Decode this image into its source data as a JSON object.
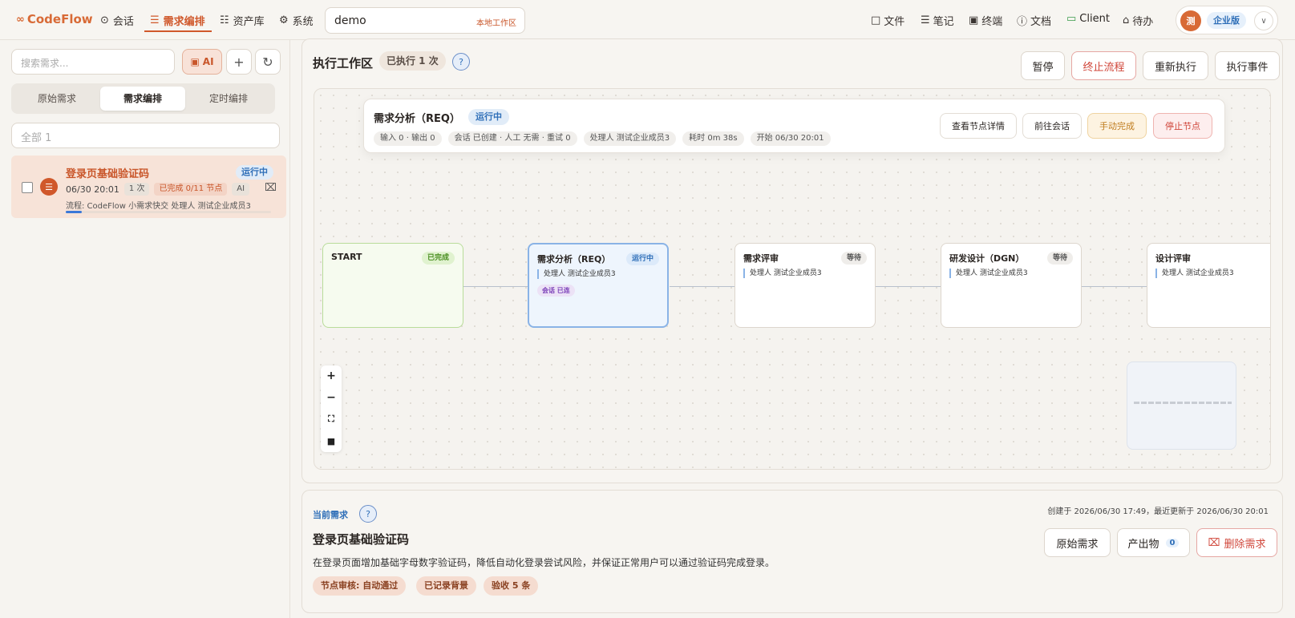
{
  "app": {
    "logo": "CodeFlow"
  },
  "nav": [
    {
      "label": "会话",
      "icon": "chat-bubble-icon"
    },
    {
      "label": "需求编排",
      "icon": "document-icon"
    },
    {
      "label": "资产库",
      "icon": "hierarchy-icon"
    },
    {
      "label": "系统",
      "icon": "gear-icon"
    }
  ],
  "workspace": {
    "value": "demo",
    "badge": "本地工作区"
  },
  "top_right": [
    {
      "label": "文件",
      "icon": "folder-icon"
    },
    {
      "label": "笔记",
      "icon": "note-icon"
    },
    {
      "label": "终端",
      "icon": "terminal-icon"
    },
    {
      "label": "文档",
      "icon": "help-circle-icon"
    },
    {
      "label": "Client",
      "icon": "monitor-icon"
    },
    {
      "label": "待办",
      "icon": "bell-icon"
    }
  ],
  "user": {
    "avatar": "测",
    "edition": "企业版"
  },
  "sidebar": {
    "search_placeholder": "搜索需求...",
    "ai_label": "AI",
    "tabs": [
      "原始需求",
      "需求编排",
      "定时编排"
    ],
    "filter": "全部 1",
    "request": {
      "title": "登录页基础验证码",
      "status": "运行中",
      "time": "06/30 20:01",
      "count": "1 次",
      "progress_text": "已完成 0/11 节点",
      "progress": 0.08,
      "ai": "AI",
      "flow": "流程: CodeFlow 小需求快交",
      "handler": "处理人 测试企业成员3"
    }
  },
  "workarea": {
    "title": "执行工作区",
    "exec_badge": "已执行 1 次",
    "buttons": [
      "暂停",
      "终止流程",
      "重新执行",
      "执行事件"
    ]
  },
  "info_card": {
    "title": "需求分析（REQ）",
    "status": "运行中",
    "chips": [
      "输入 0 · 输出 0",
      "会话 已创建 · 人工 无需 · 重试 0",
      "处理人 测试企业成员3",
      "耗时 0m 38s",
      "开始 06/30 20:01"
    ],
    "buttons": [
      "查看节点详情",
      "前往会话",
      "手动完成",
      "停止节点"
    ]
  },
  "nodes": [
    {
      "title": "START",
      "status": "已完成",
      "handler": "",
      "chip": ""
    },
    {
      "title": "需求分析（REQ）",
      "status": "运行中",
      "handler": "处理人 测试企业成员3",
      "chip": "会话 已连"
    },
    {
      "title": "需求评审",
      "status": "等待",
      "handler": "处理人 测试企业成员3",
      "chip": ""
    },
    {
      "title": "研发设计（DGN）",
      "status": "等待",
      "handler": "处理人 测试企业成员3",
      "chip": ""
    },
    {
      "title": "设计评审",
      "status": "",
      "handler": "处理人 测试企业成员3",
      "chip": ""
    }
  ],
  "current": {
    "label": "当前需求",
    "title": "登录页基础验证码",
    "meta": "创建于 2026/06/30 17:49，最近更新于 2026/06/30 20:01",
    "description": "在登录页面增加基础字母数字验证码，降低自动化登录尝试风险，并保证正常用户可以通过验证码完成登录。",
    "tags": [
      "节点审核: 自动通过",
      "已记录背景",
      "验收 5 条"
    ],
    "buttons": {
      "original": "原始需求",
      "artifacts": "产出物",
      "artifacts_count": "0",
      "delete": "删除需求"
    }
  }
}
